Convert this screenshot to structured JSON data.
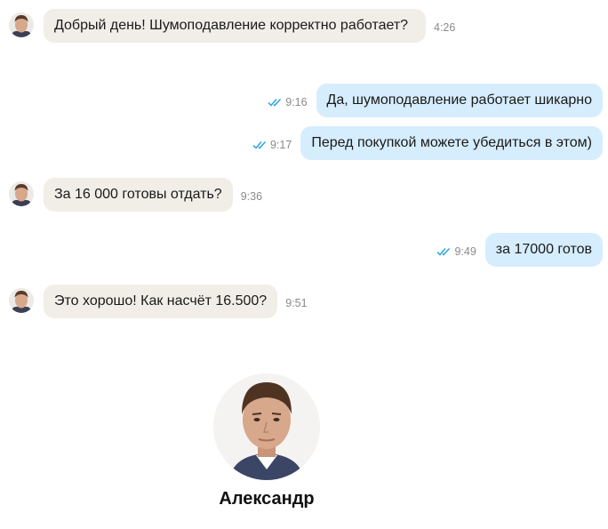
{
  "messages": [
    {
      "direction": "in",
      "text": "Добрый день! Шумоподавление корректно работает?",
      "time": "4:26"
    },
    {
      "direction": "out",
      "text": "Да, шумоподавление работает шикарно",
      "time": "9:16",
      "status": "read"
    },
    {
      "direction": "out",
      "text": "Перед покупкой можете убедиться в этом)",
      "time": "9:17",
      "status": "read"
    },
    {
      "direction": "in",
      "text": "За 16 000 готовы отдать?",
      "time": "9:36"
    },
    {
      "direction": "out",
      "text": "за 17000 готов",
      "time": "9:49",
      "status": "read"
    },
    {
      "direction": "in",
      "text": "Это хорошо! Как насчёт 16.500?",
      "time": "9:51"
    }
  ],
  "contact": {
    "name": "Александр"
  },
  "colors": {
    "incoming_bubble": "#f1eee8",
    "outgoing_bubble": "#d6edfd",
    "read_check": "#2ea3e6"
  }
}
